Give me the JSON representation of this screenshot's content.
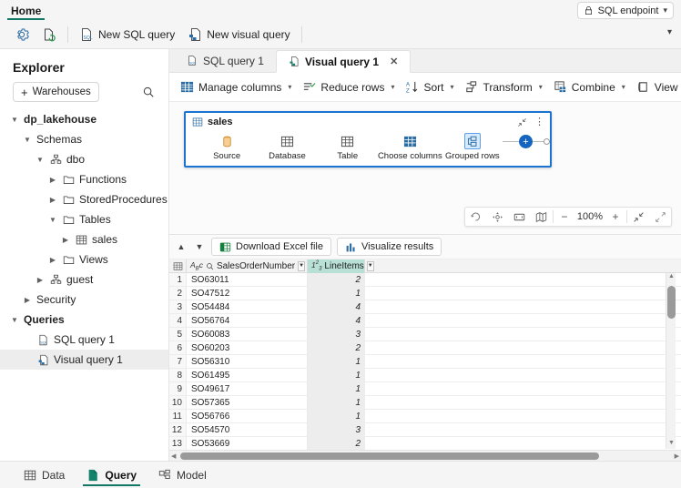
{
  "ribbon": {
    "tabs": [
      {
        "label": "Home",
        "active": true
      }
    ],
    "endpoint_button": "SQL endpoint",
    "commands": [
      {
        "label": "New SQL query",
        "icon": "new-sql-query-icon"
      },
      {
        "label": "New visual query",
        "icon": "new-visual-query-icon"
      }
    ],
    "settings_icon": "gear-icon",
    "refresh_icon": "refresh-page-icon"
  },
  "explorer": {
    "title": "Explorer",
    "add_button": "Warehouses",
    "search_icon": "search-icon",
    "tree": [
      {
        "label": "dp_lakehouse",
        "indent": 0,
        "chevron": "down",
        "icon": "none",
        "bold": true
      },
      {
        "label": "Schemas",
        "indent": 1,
        "chevron": "down",
        "icon": "none",
        "bold": false
      },
      {
        "label": "dbo",
        "indent": 2,
        "chevron": "down",
        "icon": "schema-icon",
        "bold": false
      },
      {
        "label": "Functions",
        "indent": 3,
        "chevron": "right",
        "icon": "folder-icon",
        "bold": false
      },
      {
        "label": "StoredProcedures",
        "indent": 3,
        "chevron": "right",
        "icon": "folder-icon",
        "bold": false
      },
      {
        "label": "Tables",
        "indent": 3,
        "chevron": "down",
        "icon": "folder-icon",
        "bold": false
      },
      {
        "label": "sales",
        "indent": 4,
        "chevron": "right",
        "icon": "table-icon",
        "bold": false
      },
      {
        "label": "Views",
        "indent": 3,
        "chevron": "right",
        "icon": "folder-icon",
        "bold": false
      },
      {
        "label": "guest",
        "indent": 2,
        "chevron": "right",
        "icon": "schema-icon",
        "bold": false
      },
      {
        "label": "Security",
        "indent": 1,
        "chevron": "right",
        "icon": "none",
        "bold": false
      },
      {
        "label": "Queries",
        "indent": 0,
        "chevron": "down",
        "icon": "none",
        "bold": true
      },
      {
        "label": "SQL query 1",
        "indent": 1,
        "chevron": "none",
        "icon": "sql-query-icon",
        "bold": false
      },
      {
        "label": "Visual query 1",
        "indent": 1,
        "chevron": "none",
        "icon": "visual-query-icon",
        "bold": false,
        "selected": true
      }
    ]
  },
  "doc_tabs": [
    {
      "label": "SQL query 1",
      "icon": "sql-query-icon",
      "active": false,
      "closable": false
    },
    {
      "label": "Visual query 1",
      "icon": "visual-query-icon",
      "active": true,
      "closable": true,
      "close_icon": "close-icon"
    }
  ],
  "query_toolbar": [
    {
      "label": "Manage columns",
      "icon": "manage-columns-icon",
      "caret": true
    },
    {
      "label": "Reduce rows",
      "icon": "reduce-rows-icon",
      "caret": true
    },
    {
      "label": "Sort",
      "icon": "sort-az-icon",
      "caret": true
    },
    {
      "label": "Transform",
      "icon": "transform-icon",
      "caret": true
    },
    {
      "label": "Combine",
      "icon": "combine-icon",
      "caret": true
    },
    {
      "label": "View SQL",
      "icon": "view-sql-icon",
      "caret": false
    }
  ],
  "query_toolbar_right": [
    {
      "icon": "refresh-icon"
    },
    {
      "icon": "gear-icon"
    }
  ],
  "diagram": {
    "card_title": "sales",
    "card_icon": "table-icon",
    "collapse_icon": "collapse-icon",
    "more_icon": "more-options-icon",
    "steps": [
      {
        "label": "Source",
        "icon": "source-icon",
        "selected": false
      },
      {
        "label": "Database",
        "icon": "database-grid-icon",
        "selected": false
      },
      {
        "label": "Table",
        "icon": "table-grid-icon",
        "selected": false
      },
      {
        "label": "Choose columns",
        "icon": "choose-columns-icon",
        "selected": false
      },
      {
        "label": "Grouped rows",
        "icon": "grouped-rows-icon",
        "selected": true
      }
    ],
    "add_step_icon": "plus-icon",
    "end_node_icon": "end-dot-icon"
  },
  "zoom_bar": {
    "undo_icon": "undo-icon",
    "pan_icon": "pan-icon",
    "fit_icon": "fit-to-screen-icon",
    "map_icon": "mini-map-icon",
    "minus_label": "−",
    "level": "100%",
    "plus_label": "+",
    "collapse_icon": "collapse-diagonal-icon",
    "expand_icon": "expand-diagonal-icon"
  },
  "results": {
    "chevron_up_icon": "chevron-up-icon",
    "chevron_down_icon": "chevron-down-icon",
    "buttons": [
      {
        "label": "Download Excel file",
        "icon": "excel-icon"
      },
      {
        "label": "Visualize results",
        "icon": "chart-icon"
      }
    ],
    "grid": {
      "select_all_icon": "select-all-icon",
      "columns": [
        {
          "name": "SalesOrderNumber",
          "type_icon": "abc-text-icon",
          "extra_icon": "search-icon",
          "type_label": "ABC",
          "highlighted": false
        },
        {
          "name": "LineItems",
          "type_icon": "number-123-icon",
          "type_label": "1²3",
          "highlighted": true
        }
      ],
      "rows": [
        {
          "n": "1",
          "SalesOrderNumber": "SO63011",
          "LineItems": "2"
        },
        {
          "n": "2",
          "SalesOrderNumber": "SO47512",
          "LineItems": "1"
        },
        {
          "n": "3",
          "SalesOrderNumber": "SO54484",
          "LineItems": "4"
        },
        {
          "n": "4",
          "SalesOrderNumber": "SO56764",
          "LineItems": "4"
        },
        {
          "n": "5",
          "SalesOrderNumber": "SO60083",
          "LineItems": "3"
        },
        {
          "n": "6",
          "SalesOrderNumber": "SO60203",
          "LineItems": "2"
        },
        {
          "n": "7",
          "SalesOrderNumber": "SO56310",
          "LineItems": "1"
        },
        {
          "n": "8",
          "SalesOrderNumber": "SO61495",
          "LineItems": "1"
        },
        {
          "n": "9",
          "SalesOrderNumber": "SO49617",
          "LineItems": "1"
        },
        {
          "n": "10",
          "SalesOrderNumber": "SO57365",
          "LineItems": "1"
        },
        {
          "n": "11",
          "SalesOrderNumber": "SO56766",
          "LineItems": "1"
        },
        {
          "n": "12",
          "SalesOrderNumber": "SO54570",
          "LineItems": "3"
        },
        {
          "n": "13",
          "SalesOrderNumber": "SO53669",
          "LineItems": "2"
        }
      ]
    }
  },
  "status_bar": [
    {
      "label": "Data",
      "icon": "data-grid-icon",
      "active": false
    },
    {
      "label": "Query",
      "icon": "query-page-icon",
      "active": true
    },
    {
      "label": "Model",
      "icon": "model-icon",
      "active": false
    }
  ],
  "colors": {
    "accent_green": "#117865",
    "accent_blue": "#1a73d1",
    "selected_col": "#b8e0d5",
    "plus_blue": "#1565c0"
  }
}
